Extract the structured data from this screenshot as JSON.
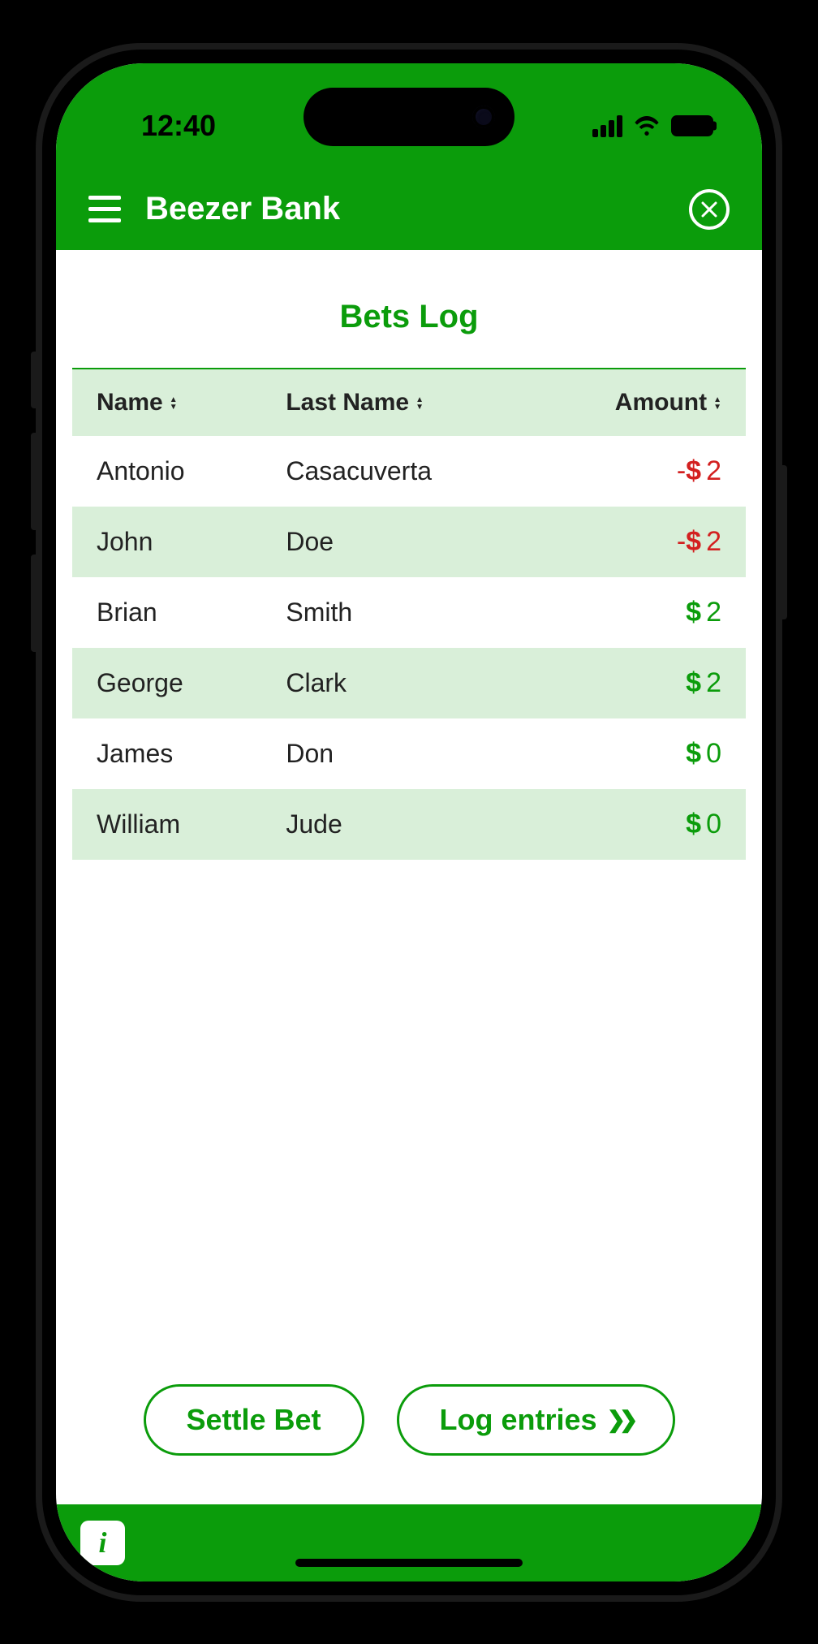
{
  "status": {
    "time": "12:40"
  },
  "header": {
    "app_title": "Beezer Bank"
  },
  "page": {
    "title": "Bets Log"
  },
  "table": {
    "columns": {
      "name": "Name",
      "last_name": "Last Name",
      "amount": "Amount"
    },
    "rows": [
      {
        "first": "Antonio",
        "last": "Casacuverta",
        "sign": "-",
        "currency": "$",
        "value": "2",
        "cls": "amount-neg"
      },
      {
        "first": "John",
        "last": "Doe",
        "sign": "-",
        "currency": "$",
        "value": "2",
        "cls": "amount-neg"
      },
      {
        "first": "Brian",
        "last": "Smith",
        "sign": "",
        "currency": "$",
        "value": "2",
        "cls": "amount-pos"
      },
      {
        "first": "George",
        "last": "Clark",
        "sign": "",
        "currency": "$",
        "value": "2",
        "cls": "amount-pos"
      },
      {
        "first": "James",
        "last": "Don",
        "sign": "",
        "currency": "$",
        "value": "0",
        "cls": "amount-pos"
      },
      {
        "first": "William",
        "last": "Jude",
        "sign": "",
        "currency": "$",
        "value": "0",
        "cls": "amount-pos"
      }
    ]
  },
  "actions": {
    "settle": "Settle Bet",
    "log_entries": "Log entries"
  },
  "footer": {
    "info_label": "i"
  }
}
